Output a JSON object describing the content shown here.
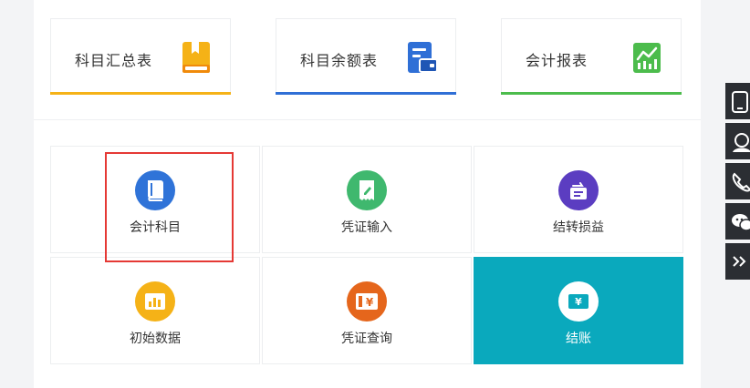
{
  "reports": [
    {
      "label": "科目汇总表",
      "accent": "#f5b217",
      "icon": "notebook-icon"
    },
    {
      "label": "科目余额表",
      "accent": "#2f6fd6",
      "icon": "wallet-icon"
    },
    {
      "label": "会计报表",
      "accent": "#4cbc4c",
      "icon": "chart-icon"
    }
  ],
  "tiles": [
    {
      "label": "会计科目",
      "icon": "book-icon",
      "color": "#2f73d8"
    },
    {
      "label": "凭证输入",
      "icon": "voucher-edit-icon",
      "color": "#3fb86e"
    },
    {
      "label": "结转损益",
      "icon": "transfer-icon",
      "color": "#5b3dc1"
    },
    {
      "label": "初始数据",
      "icon": "data-chart-icon",
      "color": "#f5b217"
    },
    {
      "label": "凭证查询",
      "icon": "voucher-search-icon",
      "color": "#e5661c"
    },
    {
      "label": "结账",
      "icon": "checkout-icon",
      "color": "#0aa9bd",
      "active": true
    }
  ],
  "side_toolbar": [
    {
      "icon": "mobile-icon"
    },
    {
      "icon": "customer-service-icon"
    },
    {
      "icon": "phone-icon"
    },
    {
      "icon": "wechat-icon"
    },
    {
      "icon": "collapse-icon"
    }
  ]
}
